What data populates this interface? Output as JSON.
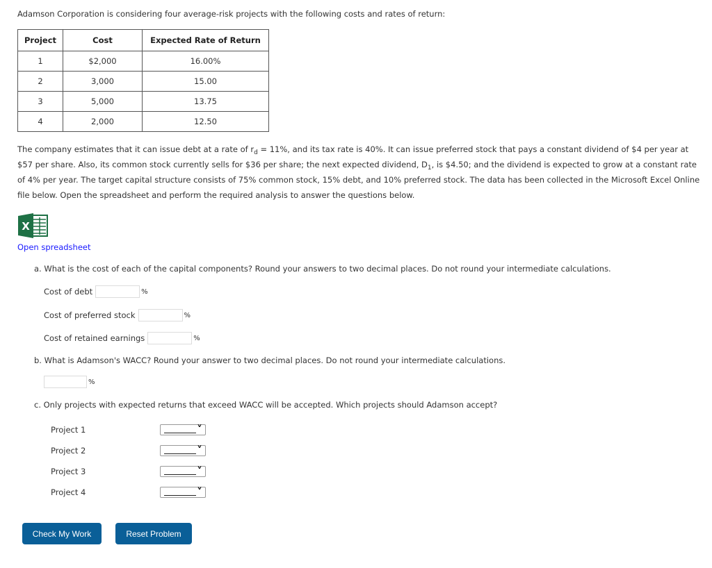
{
  "intro": "Adamson Corporation is considering four average-risk projects with the following costs and rates of return:",
  "table": {
    "headers": [
      "Project",
      "Cost",
      "Expected Rate of Return"
    ],
    "rows": [
      [
        "1",
        "$2,000",
        "16.00%"
      ],
      [
        "2",
        "3,000",
        "15.00"
      ],
      [
        "3",
        "5,000",
        "13.75"
      ],
      [
        "4",
        "2,000",
        "12.50"
      ]
    ]
  },
  "paragraph": {
    "p1": "The company estimates that it can issue debt at a rate of r",
    "sub_d": "d",
    "p2": " = 11%, and its tax rate is 40%. It can issue preferred stock that pays a constant dividend of $4 per year at $57 per share. Also, its common stock currently sells for $36 per share; the next expected dividend, D",
    "sub_1": "1",
    "p3": ", is $4.50; and the dividend is expected to grow at a constant rate of 4% per year. The target capital structure consists of 75% common stock, 15% debt, and 10% preferred stock. The data has been collected in the Microsoft Excel Online file below. Open the spreadsheet and perform the required analysis to answer the questions below."
  },
  "spreadsheet": {
    "icon": "excel-icon",
    "link_label": "Open spreadsheet",
    "brand_color": "#1e7145"
  },
  "question_a": {
    "text": "a. What is the cost of each of the capital components? Round your answers to two decimal places. Do not round your intermediate calculations.",
    "fields": [
      {
        "label": "Cost of debt",
        "value": "",
        "unit": "%"
      },
      {
        "label": "Cost of preferred stock",
        "value": "",
        "unit": "%"
      },
      {
        "label": "Cost of retained earnings",
        "value": "",
        "unit": "%"
      }
    ]
  },
  "question_b": {
    "text": "b. What is Adamson's WACC? Round your answer to two decimal places. Do not round your intermediate calculations.",
    "value": "",
    "unit": "%"
  },
  "question_c": {
    "text": "c. Only projects with expected returns that exceed WACC will be accepted. Which projects should Adamson accept?",
    "projects": [
      {
        "label": "Project 1",
        "selected": ""
      },
      {
        "label": "Project 2",
        "selected": ""
      },
      {
        "label": "Project 3",
        "selected": ""
      },
      {
        "label": "Project 4",
        "selected": ""
      }
    ]
  },
  "buttons": {
    "check": "Check My Work",
    "reset": "Reset Problem",
    "color": "#0a5f98"
  }
}
